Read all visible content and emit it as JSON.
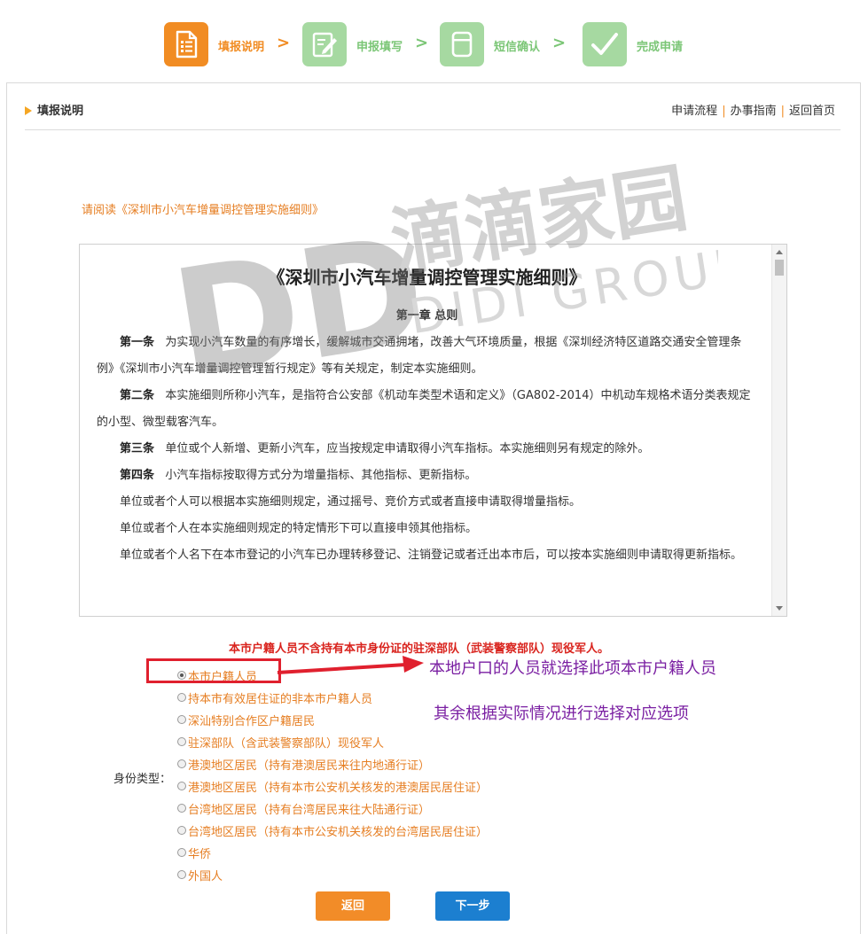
{
  "steps": [
    {
      "label": "填报说明",
      "icon": "document-list-icon",
      "active": true
    },
    {
      "label": "申报填写",
      "icon": "edit-form-icon",
      "active": false
    },
    {
      "label": "短信确认",
      "icon": "phone-message-icon",
      "active": false
    },
    {
      "label": "完成申请",
      "icon": "checkmark-icon",
      "active": false
    }
  ],
  "step_arrow": ">",
  "header": {
    "title": "填报说明",
    "links": [
      "申请流程",
      "办事指南",
      "返回首页"
    ],
    "separator": "|"
  },
  "read_notice": "请阅读《深圳市小汽车增量调控管理实施细则》",
  "rules": {
    "title": "《深圳市小汽车增量调控管理实施细则》",
    "chapter": "第一章 总则",
    "paragraphs": [
      {
        "lead": "第一条",
        "text": "为实现小汽车数量的有序增长，缓解城市交通拥堵，改善大气环境质量，根据《深圳经济特区道路交通安全管理条例》《深圳市小汽车增量调控管理暂行规定》等有关规定，制定本实施细则。"
      },
      {
        "lead": "第二条",
        "text": "本实施细则所称小汽车，是指符合公安部《机动车类型术语和定义》（GA802-2014）中机动车规格术语分类表规定的小型、微型载客汽车。"
      },
      {
        "lead": "第三条",
        "text": "单位或个人新增、更新小汽车，应当按规定申请取得小汽车指标。本实施细则另有规定的除外。"
      },
      {
        "lead": "第四条",
        "text": "小汽车指标按取得方式分为增量指标、其他指标、更新指标。"
      },
      {
        "lead": "",
        "text": "单位或者个人可以根据本实施细则规定，通过摇号、竞价方式或者直接申请取得增量指标。"
      },
      {
        "lead": "",
        "text": "单位或者个人在本实施细则规定的特定情形下可以直接申领其他指标。"
      },
      {
        "lead": "",
        "text": "单位或者个人名下在本市登记的小汽车已办理转移登记、注销登记或者迁出本市后，可以按本实施细则申请取得更新指标。"
      }
    ]
  },
  "form": {
    "warning": "本市户籍人员不含持有本市身份证的驻深部队（武装警察部队）现役军人。",
    "identity_label": "身份类型：",
    "options": [
      "本市户籍人员",
      "持本市有效居住证的非本市户籍人员",
      "深汕特别合作区户籍居民",
      "驻深部队（含武装警察部队）现役军人",
      "港澳地区居民（持有港澳居民来往内地通行证）",
      "港澳地区居民（持有本市公安机关核发的港澳居民居住证）",
      "台湾地区居民（持有台湾居民来往大陆通行证）",
      "台湾地区居民（持有本市公安机关核发的台湾居民居住证）",
      "华侨",
      "外国人"
    ],
    "selected_index": 0
  },
  "annotations": {
    "note1": "本地户口的人员就选择此项本市户籍人员",
    "note2": "其余根据实际情况进行选择对应选项",
    "highlight_color": "#e0202e",
    "note_color": "#7a1fa2"
  },
  "buttons": {
    "back": "返回",
    "next": "下一步"
  },
  "watermark": {
    "logo": "DD",
    "cn": "滴滴家园",
    "en": "DIDI GROUP"
  },
  "colors": {
    "accent_orange": "#f18c23",
    "step_green": "#a6d9a1",
    "next_blue": "#1c7fd0",
    "warning_red": "#d9231d"
  }
}
